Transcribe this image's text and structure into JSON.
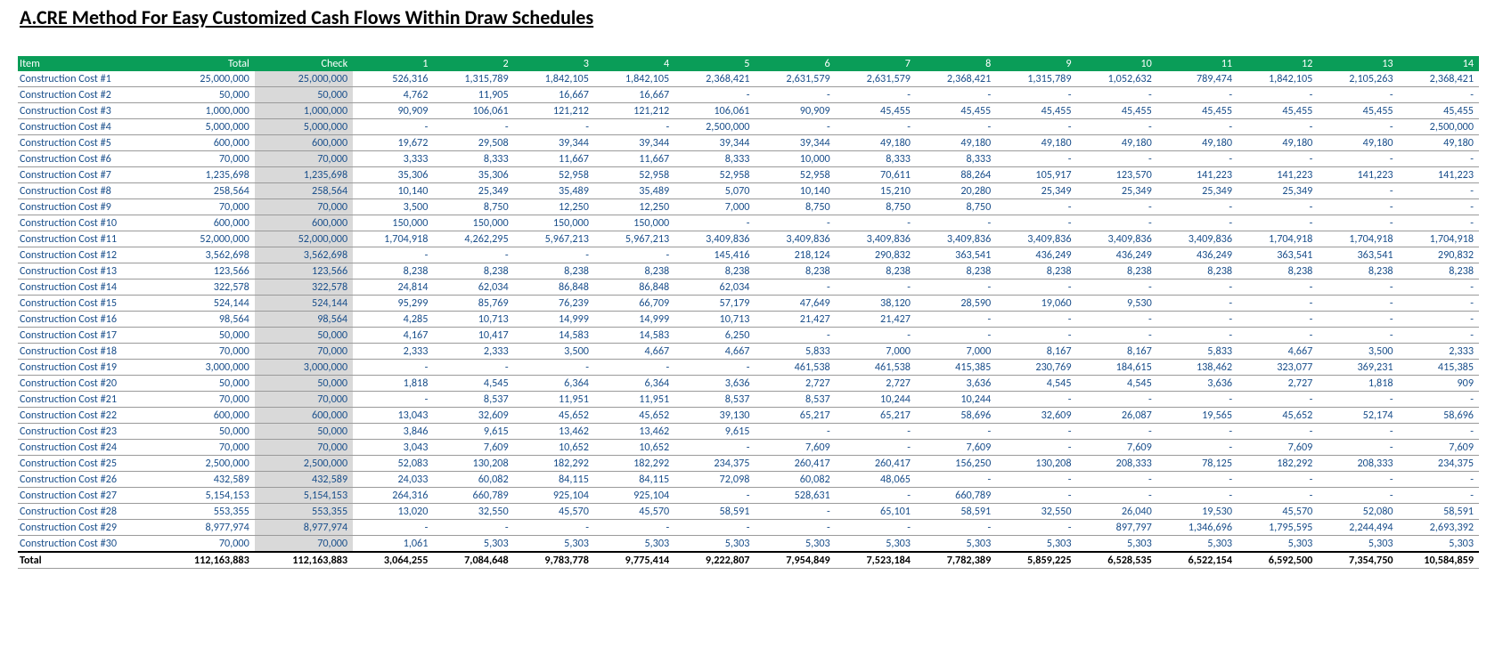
{
  "title": "A.CRE Method For Easy Customized Cash Flows Within Draw Schedules",
  "headers": [
    "Item",
    "Total",
    "Check",
    "1",
    "2",
    "3",
    "4",
    "5",
    "6",
    "7",
    "8",
    "9",
    "10",
    "11",
    "12",
    "13",
    "14"
  ],
  "rows": [
    {
      "item": "Construction Cost #1",
      "total": "25,000,000",
      "check": "25,000,000",
      "v": [
        "526,316",
        "1,315,789",
        "1,842,105",
        "1,842,105",
        "2,368,421",
        "2,631,579",
        "2,631,579",
        "2,368,421",
        "1,315,789",
        "1,052,632",
        "789,474",
        "1,842,105",
        "2,105,263",
        "2,368,421"
      ]
    },
    {
      "item": "Construction Cost #2",
      "total": "50,000",
      "check": "50,000",
      "v": [
        "4,762",
        "11,905",
        "16,667",
        "16,667",
        "-",
        "-",
        "-",
        "-",
        "-",
        "-",
        "-",
        "-",
        "-",
        "-"
      ]
    },
    {
      "item": "Construction Cost #3",
      "total": "1,000,000",
      "check": "1,000,000",
      "v": [
        "90,909",
        "106,061",
        "121,212",
        "121,212",
        "106,061",
        "90,909",
        "45,455",
        "45,455",
        "45,455",
        "45,455",
        "45,455",
        "45,455",
        "45,455",
        "45,455"
      ]
    },
    {
      "item": "Construction Cost #4",
      "total": "5,000,000",
      "check": "5,000,000",
      "v": [
        "-",
        "-",
        "-",
        "-",
        "2,500,000",
        "-",
        "-",
        "-",
        "-",
        "-",
        "-",
        "-",
        "-",
        "2,500,000"
      ]
    },
    {
      "item": "Construction Cost #5",
      "total": "600,000",
      "check": "600,000",
      "v": [
        "19,672",
        "29,508",
        "39,344",
        "39,344",
        "39,344",
        "39,344",
        "49,180",
        "49,180",
        "49,180",
        "49,180",
        "49,180",
        "49,180",
        "49,180",
        "49,180"
      ]
    },
    {
      "item": "Construction Cost #6",
      "total": "70,000",
      "check": "70,000",
      "v": [
        "3,333",
        "8,333",
        "11,667",
        "11,667",
        "8,333",
        "10,000",
        "8,333",
        "8,333",
        "-",
        "-",
        "-",
        "-",
        "-",
        "-"
      ]
    },
    {
      "item": "Construction Cost #7",
      "total": "1,235,698",
      "check": "1,235,698",
      "v": [
        "35,306",
        "35,306",
        "52,958",
        "52,958",
        "52,958",
        "52,958",
        "70,611",
        "88,264",
        "105,917",
        "123,570",
        "141,223",
        "141,223",
        "141,223",
        "141,223"
      ]
    },
    {
      "item": "Construction Cost #8",
      "total": "258,564",
      "check": "258,564",
      "v": [
        "10,140",
        "25,349",
        "35,489",
        "35,489",
        "5,070",
        "10,140",
        "15,210",
        "20,280",
        "25,349",
        "25,349",
        "25,349",
        "25,349",
        "-",
        "-"
      ]
    },
    {
      "item": "Construction Cost #9",
      "total": "70,000",
      "check": "70,000",
      "v": [
        "3,500",
        "8,750",
        "12,250",
        "12,250",
        "7,000",
        "8,750",
        "8,750",
        "8,750",
        "-",
        "-",
        "-",
        "-",
        "-",
        "-"
      ]
    },
    {
      "item": "Construction Cost #10",
      "total": "600,000",
      "check": "600,000",
      "v": [
        "150,000",
        "150,000",
        "150,000",
        "150,000",
        "-",
        "-",
        "-",
        "-",
        "-",
        "-",
        "-",
        "-",
        "-",
        "-"
      ]
    },
    {
      "item": "Construction Cost #11",
      "total": "52,000,000",
      "check": "52,000,000",
      "v": [
        "1,704,918",
        "4,262,295",
        "5,967,213",
        "5,967,213",
        "3,409,836",
        "3,409,836",
        "3,409,836",
        "3,409,836",
        "3,409,836",
        "3,409,836",
        "3,409,836",
        "1,704,918",
        "1,704,918",
        "1,704,918"
      ]
    },
    {
      "item": "Construction Cost #12",
      "total": "3,562,698",
      "check": "3,562,698",
      "v": [
        "-",
        "-",
        "-",
        "-",
        "145,416",
        "218,124",
        "290,832",
        "363,541",
        "436,249",
        "436,249",
        "436,249",
        "363,541",
        "363,541",
        "290,832"
      ]
    },
    {
      "item": "Construction Cost #13",
      "total": "123,566",
      "check": "123,566",
      "v": [
        "8,238",
        "8,238",
        "8,238",
        "8,238",
        "8,238",
        "8,238",
        "8,238",
        "8,238",
        "8,238",
        "8,238",
        "8,238",
        "8,238",
        "8,238",
        "8,238"
      ]
    },
    {
      "item": "Construction Cost #14",
      "total": "322,578",
      "check": "322,578",
      "v": [
        "24,814",
        "62,034",
        "86,848",
        "86,848",
        "62,034",
        "-",
        "-",
        "-",
        "-",
        "-",
        "-",
        "-",
        "-",
        "-"
      ]
    },
    {
      "item": "Construction Cost #15",
      "total": "524,144",
      "check": "524,144",
      "v": [
        "95,299",
        "85,769",
        "76,239",
        "66,709",
        "57,179",
        "47,649",
        "38,120",
        "28,590",
        "19,060",
        "9,530",
        "-",
        "-",
        "-",
        "-"
      ]
    },
    {
      "item": "Construction Cost #16",
      "total": "98,564",
      "check": "98,564",
      "v": [
        "4,285",
        "10,713",
        "14,999",
        "14,999",
        "10,713",
        "21,427",
        "21,427",
        "-",
        "-",
        "-",
        "-",
        "-",
        "-",
        "-"
      ]
    },
    {
      "item": "Construction Cost #17",
      "total": "50,000",
      "check": "50,000",
      "v": [
        "4,167",
        "10,417",
        "14,583",
        "14,583",
        "6,250",
        "-",
        "-",
        "-",
        "-",
        "-",
        "-",
        "-",
        "-",
        "-"
      ]
    },
    {
      "item": "Construction Cost #18",
      "total": "70,000",
      "check": "70,000",
      "v": [
        "2,333",
        "2,333",
        "3,500",
        "4,667",
        "4,667",
        "5,833",
        "7,000",
        "7,000",
        "8,167",
        "8,167",
        "5,833",
        "4,667",
        "3,500",
        "2,333"
      ]
    },
    {
      "item": "Construction Cost #19",
      "total": "3,000,000",
      "check": "3,000,000",
      "v": [
        "-",
        "-",
        "-",
        "-",
        "-",
        "461,538",
        "461,538",
        "415,385",
        "230,769",
        "184,615",
        "138,462",
        "323,077",
        "369,231",
        "415,385"
      ]
    },
    {
      "item": "Construction Cost #20",
      "total": "50,000",
      "check": "50,000",
      "v": [
        "1,818",
        "4,545",
        "6,364",
        "6,364",
        "3,636",
        "2,727",
        "2,727",
        "3,636",
        "4,545",
        "4,545",
        "3,636",
        "2,727",
        "1,818",
        "909"
      ]
    },
    {
      "item": "Construction Cost #21",
      "total": "70,000",
      "check": "70,000",
      "v": [
        "-",
        "8,537",
        "11,951",
        "11,951",
        "8,537",
        "8,537",
        "10,244",
        "10,244",
        "-",
        "-",
        "-",
        "-",
        "-",
        "-"
      ]
    },
    {
      "item": "Construction Cost #22",
      "total": "600,000",
      "check": "600,000",
      "v": [
        "13,043",
        "32,609",
        "45,652",
        "45,652",
        "39,130",
        "65,217",
        "65,217",
        "58,696",
        "32,609",
        "26,087",
        "19,565",
        "45,652",
        "52,174",
        "58,696"
      ]
    },
    {
      "item": "Construction Cost #23",
      "total": "50,000",
      "check": "50,000",
      "v": [
        "3,846",
        "9,615",
        "13,462",
        "13,462",
        "9,615",
        "-",
        "-",
        "-",
        "-",
        "-",
        "-",
        "-",
        "-",
        "-"
      ]
    },
    {
      "item": "Construction Cost #24",
      "total": "70,000",
      "check": "70,000",
      "v": [
        "3,043",
        "7,609",
        "10,652",
        "10,652",
        "-",
        "7,609",
        "-",
        "7,609",
        "-",
        "7,609",
        "-",
        "7,609",
        "-",
        "7,609"
      ]
    },
    {
      "item": "Construction Cost #25",
      "total": "2,500,000",
      "check": "2,500,000",
      "v": [
        "52,083",
        "130,208",
        "182,292",
        "182,292",
        "234,375",
        "260,417",
        "260,417",
        "156,250",
        "130,208",
        "208,333",
        "78,125",
        "182,292",
        "208,333",
        "234,375"
      ]
    },
    {
      "item": "Construction Cost #26",
      "total": "432,589",
      "check": "432,589",
      "v": [
        "24,033",
        "60,082",
        "84,115",
        "84,115",
        "72,098",
        "60,082",
        "48,065",
        "-",
        "-",
        "-",
        "-",
        "-",
        "-",
        "-"
      ]
    },
    {
      "item": "Construction Cost #27",
      "total": "5,154,153",
      "check": "5,154,153",
      "v": [
        "264,316",
        "660,789",
        "925,104",
        "925,104",
        "-",
        "528,631",
        "-",
        "660,789",
        "-",
        "-",
        "-",
        "-",
        "-",
        "-"
      ]
    },
    {
      "item": "Construction Cost #28",
      "total": "553,355",
      "check": "553,355",
      "v": [
        "13,020",
        "32,550",
        "45,570",
        "45,570",
        "58,591",
        "-",
        "65,101",
        "58,591",
        "32,550",
        "26,040",
        "19,530",
        "45,570",
        "52,080",
        "58,591"
      ]
    },
    {
      "item": "Construction Cost #29",
      "total": "8,977,974",
      "check": "8,977,974",
      "v": [
        "-",
        "-",
        "-",
        "-",
        "-",
        "-",
        "-",
        "-",
        "-",
        "897,797",
        "1,346,696",
        "1,795,595",
        "2,244,494",
        "2,693,392"
      ]
    },
    {
      "item": "Construction Cost #30",
      "total": "70,000",
      "check": "70,000",
      "v": [
        "1,061",
        "5,303",
        "5,303",
        "5,303",
        "5,303",
        "5,303",
        "5,303",
        "5,303",
        "5,303",
        "5,303",
        "5,303",
        "5,303",
        "5,303",
        "5,303"
      ]
    }
  ],
  "totals": {
    "item": "Total",
    "total": "112,163,883",
    "check": "112,163,883",
    "v": [
      "3,064,255",
      "7,084,648",
      "9,783,778",
      "9,775,414",
      "9,222,807",
      "7,954,849",
      "7,523,184",
      "7,782,389",
      "5,859,225",
      "6,528,535",
      "6,522,154",
      "6,592,500",
      "7,354,750",
      "10,584,859"
    ]
  }
}
